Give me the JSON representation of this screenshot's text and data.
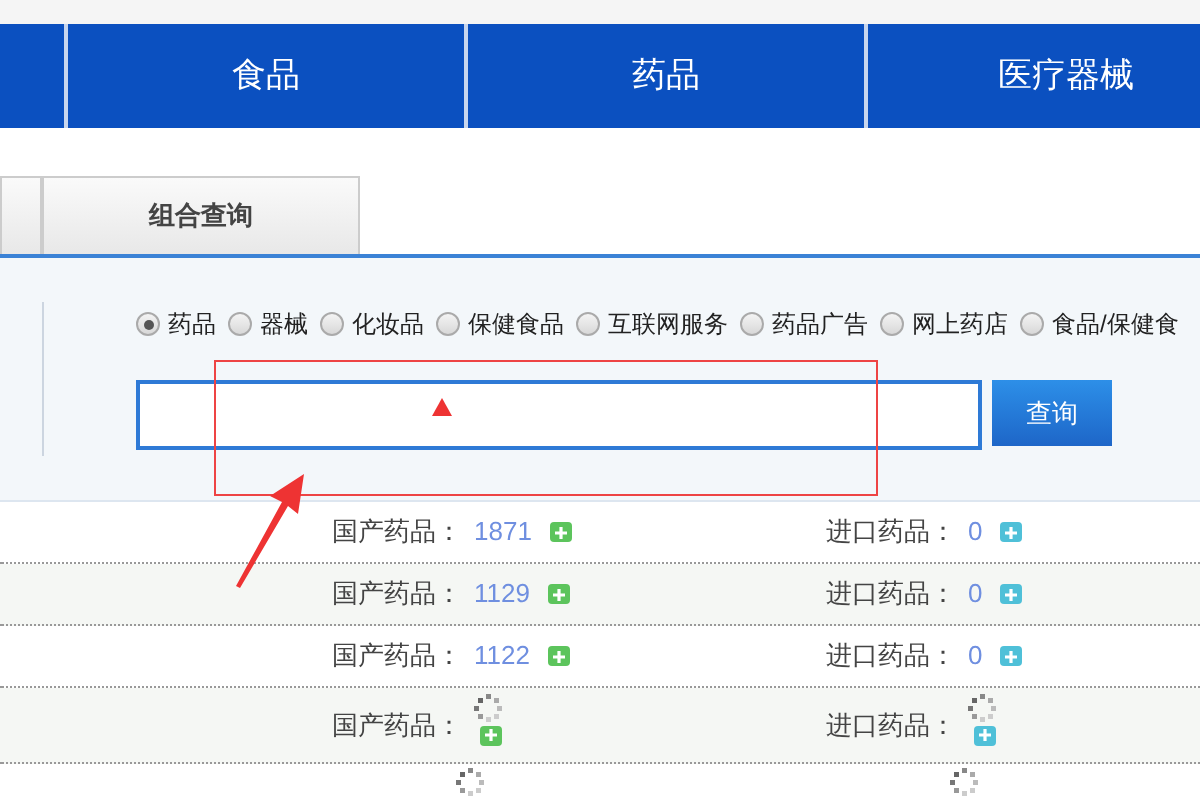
{
  "nav": {
    "items": [
      {
        "label": "食品"
      },
      {
        "label": "药品"
      },
      {
        "label": "医疗器械"
      }
    ]
  },
  "tabs": [
    {
      "selected": false
    },
    {
      "label": "组合查询",
      "selected": false
    }
  ],
  "search": {
    "options": [
      {
        "label": "药品",
        "selected": true
      },
      {
        "label": "器械",
        "selected": false
      },
      {
        "label": "化妆品",
        "selected": false
      },
      {
        "label": "保健食品",
        "selected": false
      },
      {
        "label": "互联网服务",
        "selected": false
      },
      {
        "label": "药品广告",
        "selected": false
      },
      {
        "label": "网上药店",
        "selected": false
      },
      {
        "label": "食品/保健食",
        "selected": false
      }
    ],
    "button": "查询"
  },
  "rows": [
    {
      "kind": "count",
      "domestic_label": "国产药品：",
      "domestic_count": "1871",
      "import_label": "进口药品：",
      "import_count": "0"
    },
    {
      "kind": "count",
      "domestic_label": "国产药品：",
      "domestic_count": "1129",
      "import_label": "进口药品：",
      "import_count": "0"
    },
    {
      "kind": "count",
      "domestic_label": "国产药品：",
      "domestic_count": "1122",
      "import_label": "进口药品：",
      "import_count": "0"
    },
    {
      "kind": "loading",
      "domestic_label": "国产药品：",
      "import_label": "进口药品："
    },
    {
      "kind": "cut"
    }
  ]
}
